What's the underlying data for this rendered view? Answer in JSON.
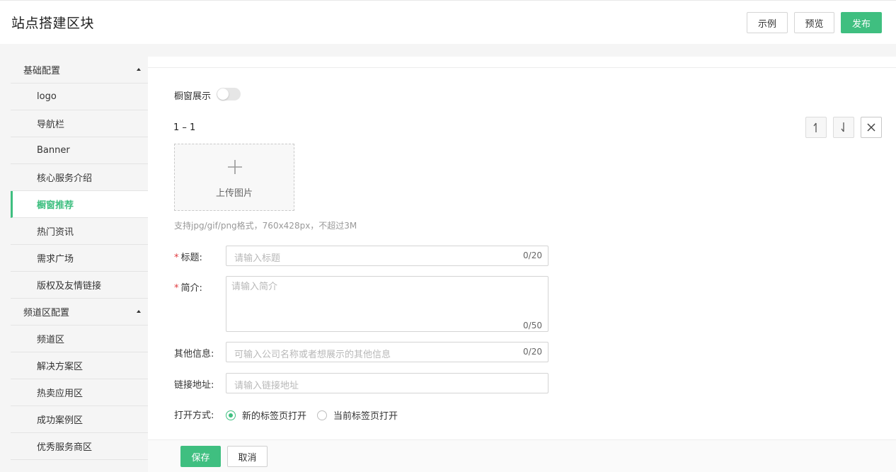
{
  "header": {
    "title": "站点搭建区块",
    "buttons": {
      "example": "示例",
      "preview": "预览",
      "publish": "发布"
    }
  },
  "sidebar": {
    "groups": [
      {
        "label": "基础配置",
        "items": [
          "logo",
          "导航栏",
          "Banner",
          "核心服务介绍",
          "橱窗推荐",
          "热门资讯",
          "需求广场",
          "版权及友情链接"
        ]
      },
      {
        "label": "频道区配置",
        "items": [
          "频道区",
          "解决方案区",
          "热卖应用区",
          "成功案例区",
          "优秀服务商区"
        ]
      }
    ],
    "active": "橱窗推荐"
  },
  "form": {
    "showcase_label": "橱窗展示",
    "showcase_enabled": false,
    "index_label": "1 – 1",
    "upload_text": "上传图片",
    "upload_hint": "支持jpg/gif/png格式，760x428px，不超过3M",
    "title_label": "标题:",
    "title_placeholder": "请输入标题",
    "title_count": "0/20",
    "intro_label": "简介:",
    "intro_placeholder": "请输入简介",
    "intro_count": "0/50",
    "other_label": "其他信息:",
    "other_placeholder": "可输入公司名称或者想展示的其他信息",
    "other_count": "0/20",
    "link_label": "链接地址:",
    "link_placeholder": "请输入链接地址",
    "open_label": "打开方式:",
    "open_options": [
      "新的标签页打开",
      "当前标签页打开"
    ],
    "open_selected": "新的标签页打开"
  },
  "footer": {
    "save": "保存",
    "cancel": "取消"
  },
  "colors": {
    "accent": "#3fbf80",
    "required": "#e0393e"
  },
  "icons": [
    "arrow-up-icon",
    "arrow-down-icon",
    "close-icon",
    "plus-icon",
    "caret-up-icon"
  ]
}
